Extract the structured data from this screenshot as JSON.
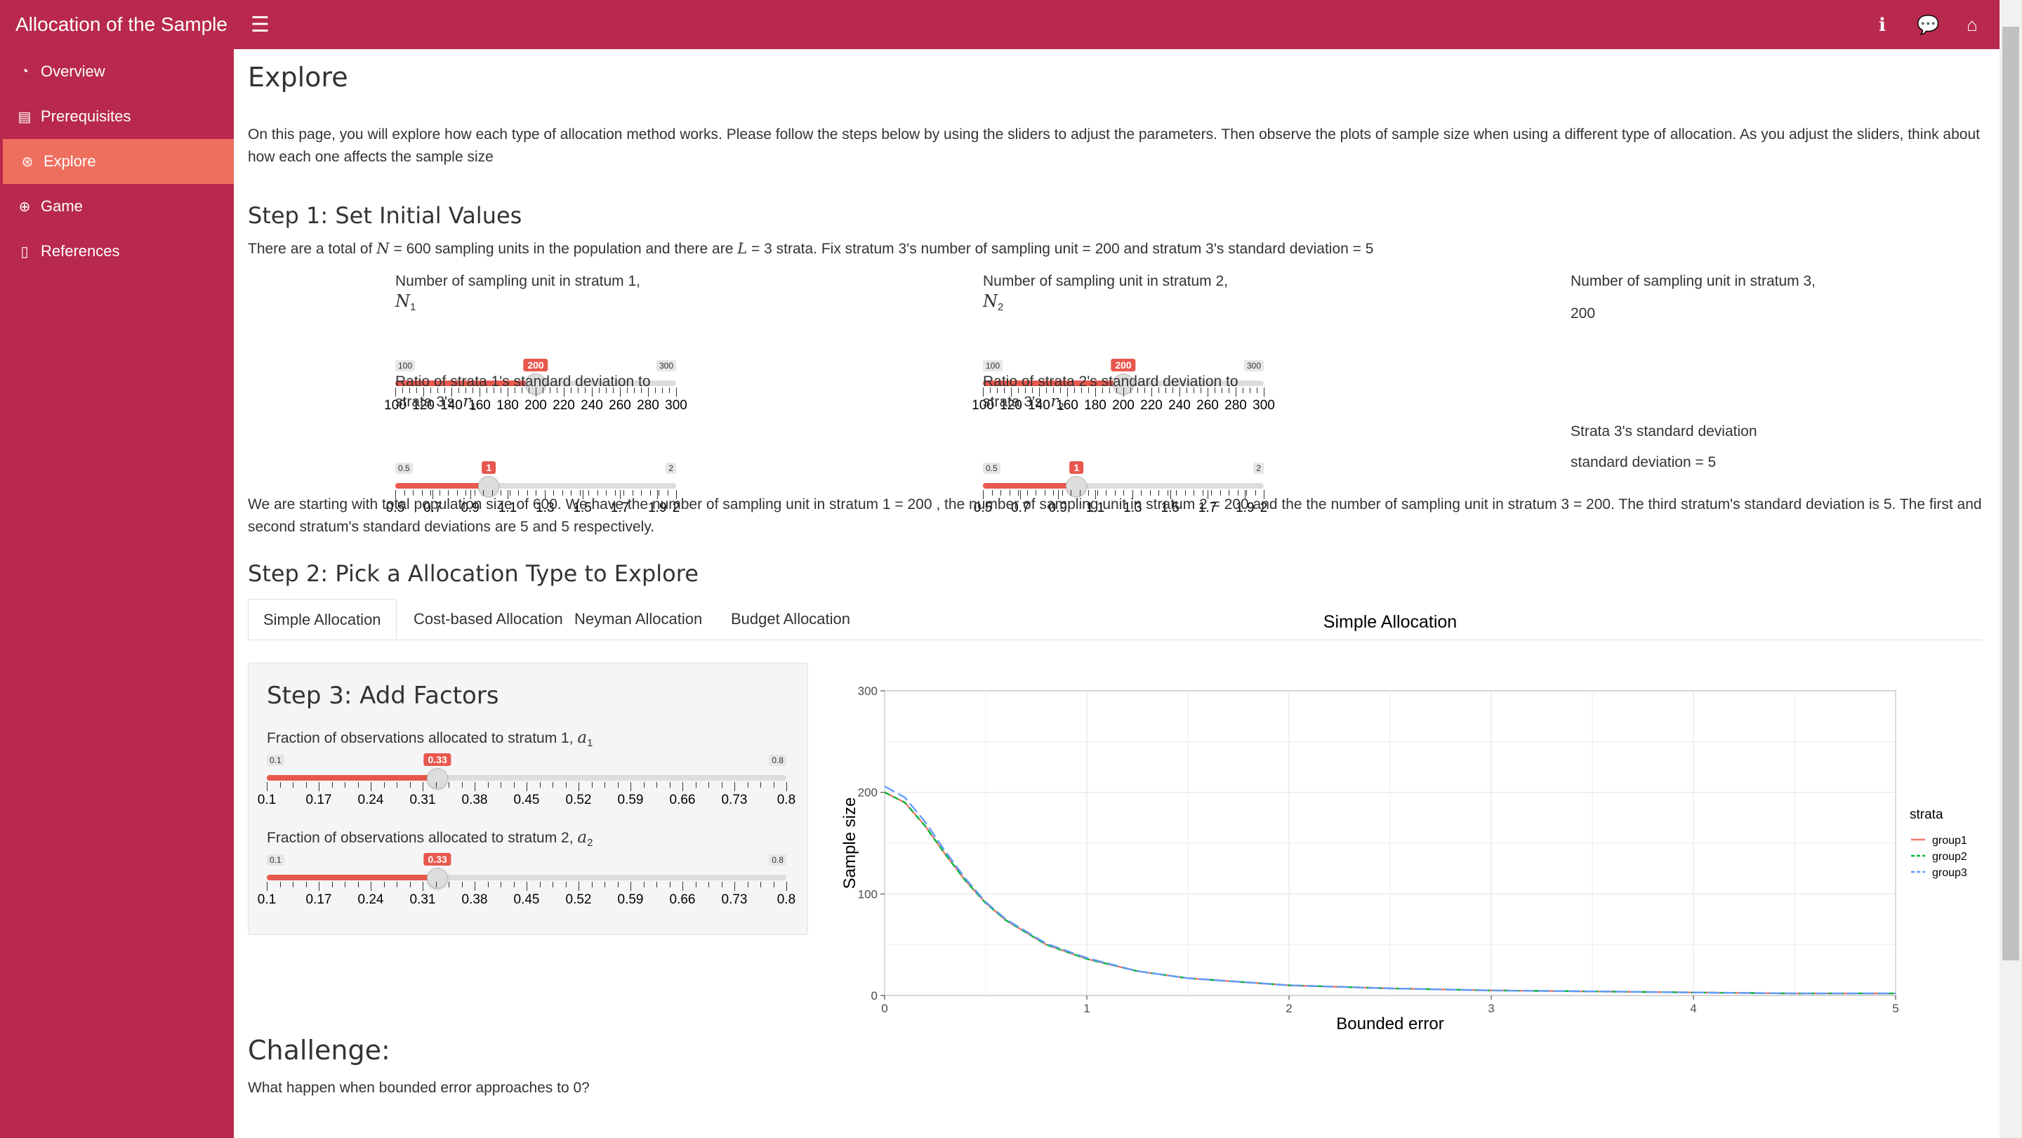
{
  "app": {
    "title": "Allocation of the Sample"
  },
  "header": {
    "menu_icon": "hamburger-icon",
    "icons": [
      "info-icon",
      "comments-icon",
      "home-icon"
    ]
  },
  "sidebar": {
    "items": [
      {
        "label": "Overview",
        "icon": "dashboard-icon"
      },
      {
        "label": "Prerequisites",
        "icon": "book-icon"
      },
      {
        "label": "Explore",
        "icon": "wpexplorer-icon",
        "active": true
      },
      {
        "label": "Game",
        "icon": "gamepad-icon"
      },
      {
        "label": "References",
        "icon": "leanpub-icon"
      }
    ]
  },
  "page": {
    "title": "Explore",
    "intro": "On this page, you will explore how each type of allocation method works. Please follow the steps below by using the sliders to adjust the parameters. Then observe the plots of sample size when using a different type of allocation. As you adjust the sliders, think about how each one affects the sample size",
    "step1_title": "Step 1: Set Initial Values",
    "step1_text_a": "There are a total of ",
    "step1_N": "N",
    "step1_text_b": " = 600 sampling units in the population and there are ",
    "step1_L": "L",
    "step1_text_c": " = 3 strata. Fix stratum 3's number of sampling unit = 200 and stratum 3's standard deviation = 5",
    "summary": "We are starting with total population size of 600. We have the number of sampling unit in stratum 1 = 200 , the number of sampling unit in stratum 2 = 200 and the the number of sampling unit in stratum 3 = 200. The third stratum's standard deviation is 5. The first and second stratum's standard deviations are 5 and 5 respectively.",
    "step2_title": "Step 2: Pick a Allocation Type to Explore",
    "challenge_title": "Challenge:",
    "challenge_text": "What happen when bounded error approaches to 0?"
  },
  "sliders_step1": {
    "n1": {
      "label": "Number of sampling unit in stratum 1,",
      "symbol": "N",
      "sub": "1",
      "min": "100",
      "max": "300",
      "value": "200",
      "fraction": 0.5,
      "ticks": [
        "100",
        "120",
        "140",
        "160",
        "180",
        "200",
        "220",
        "240",
        "260",
        "280",
        "300"
      ]
    },
    "n2": {
      "label": "Number of sampling unit in stratum 2,",
      "symbol": "N",
      "sub": "2",
      "min": "100",
      "max": "300",
      "value": "200",
      "fraction": 0.5,
      "ticks": [
        "100",
        "120",
        "140",
        "160",
        "180",
        "200",
        "220",
        "240",
        "260",
        "280",
        "300"
      ]
    },
    "r1": {
      "label": "Ratio of strata 1's standard deviation to",
      "label2": "strata 3's, ",
      "symbol": "r",
      "sub": "1",
      "min": "0.5",
      "max": "2",
      "value": "1",
      "fraction": 0.3333,
      "ticks": [
        "0.5",
        "0.7",
        "0.9",
        "1.1",
        "1.3",
        "1.5",
        "1.7",
        "1.9",
        "2"
      ]
    },
    "r2": {
      "label": "Ratio of strata 2's standard deviation to",
      "label2": "strata 3's, ",
      "symbol": "r",
      "sub": "2",
      "min": "0.5",
      "max": "2",
      "value": "1",
      "fraction": 0.3333,
      "ticks": [
        "0.5",
        "0.7",
        "0.9",
        "1.1",
        "1.3",
        "1.5",
        "1.7",
        "1.9",
        "2"
      ]
    }
  },
  "stratum3": {
    "n_label": "Number of sampling unit in stratum 3,",
    "n_value": "200",
    "sd_label": "Strata 3's standard deviation",
    "sd_value": "standard deviation = 5"
  },
  "tabs": [
    {
      "label": "Simple Allocation",
      "active": true
    },
    {
      "label": "Cost-based Allocation"
    },
    {
      "label": "Neyman Allocation"
    },
    {
      "label": "Budget Allocation"
    }
  ],
  "step3": {
    "title": "Step 3: Add Factors",
    "a1": {
      "label": "Fraction of observations allocated to stratum 1, ",
      "symbol": "a",
      "sub": "1",
      "min": "0.1",
      "max": "0.8",
      "value": "0.33",
      "fraction": 0.3286,
      "ticks": [
        "0.1",
        "0.17",
        "0.24",
        "0.31",
        "0.38",
        "0.45",
        "0.52",
        "0.59",
        "0.66",
        "0.73",
        "0.8"
      ]
    },
    "a2": {
      "label": "Fraction of observations allocated to stratum 2, ",
      "symbol": "a",
      "sub": "2",
      "min": "0.1",
      "max": "0.8",
      "value": "0.33",
      "fraction": 0.3286,
      "ticks": [
        "0.1",
        "0.17",
        "0.24",
        "0.31",
        "0.38",
        "0.45",
        "0.52",
        "0.59",
        "0.66",
        "0.73",
        "0.8"
      ]
    }
  },
  "chart_data": {
    "type": "line",
    "title": "Simple Allocation",
    "xlabel": "Bounded error",
    "ylabel": "Sample size",
    "xlim": [
      0,
      5
    ],
    "ylim": [
      0,
      300
    ],
    "xticks": [
      "0",
      "1",
      "2",
      "3",
      "4",
      "5"
    ],
    "yticks": [
      "0",
      "100",
      "200",
      "300"
    ],
    "grid": true,
    "legend": {
      "title": "strata",
      "position": "right"
    },
    "series": [
      {
        "name": "group1",
        "color": "#F8766D",
        "dash": "solid",
        "x": [
          0.0,
          0.1,
          0.2,
          0.3,
          0.4,
          0.5,
          0.6,
          0.8,
          1.0,
          1.25,
          1.5,
          2.0,
          2.5,
          3.0,
          3.5,
          4.0,
          4.5,
          5.0
        ],
        "y": [
          200,
          190,
          167,
          139,
          113,
          91,
          74,
          50,
          36,
          24,
          17,
          10,
          7,
          5,
          4,
          3,
          2,
          2
        ]
      },
      {
        "name": "group2",
        "color": "#00BA38",
        "dash": "dashed",
        "x": [
          0.0,
          0.1,
          0.2,
          0.3,
          0.4,
          0.5,
          0.6,
          0.8,
          1.0,
          1.25,
          1.5,
          2.0,
          2.5,
          3.0,
          3.5,
          4.0,
          4.5,
          5.0
        ],
        "y": [
          200,
          190,
          167,
          139,
          113,
          91,
          74,
          50,
          36,
          24,
          17,
          10,
          7,
          5,
          4,
          3,
          2,
          2
        ]
      },
      {
        "name": "group3",
        "color": "#619CFF",
        "dash": "longdash",
        "x": [
          0.0,
          0.1,
          0.2,
          0.3,
          0.4,
          0.5,
          0.6,
          0.8,
          1.0,
          1.25,
          1.5,
          2.0,
          2.5,
          3.0,
          3.5,
          4.0,
          4.5,
          5.0
        ],
        "y": [
          206,
          195,
          171,
          142,
          115,
          92,
          75,
          51,
          37,
          24,
          17,
          10,
          7,
          5,
          4,
          3,
          2,
          2
        ]
      }
    ]
  }
}
